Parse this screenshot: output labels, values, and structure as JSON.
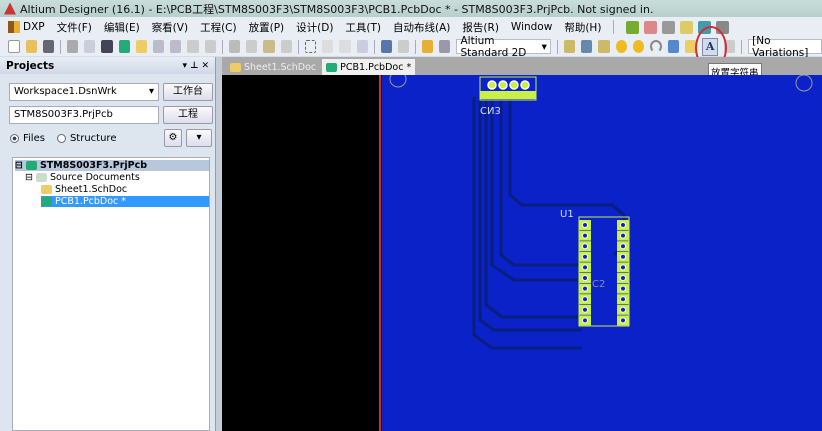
{
  "title": "Altium Designer (16.1) - E:\\PCB工程\\STM8S003F3\\STM8S003F3\\PCB1.PcbDoc * - STM8S003F3.PrjPcb. Not signed in.",
  "menu": [
    "DXP",
    "文件(F)",
    "编辑(E)",
    "察看(V)",
    "工程(C)",
    "放置(P)",
    "设计(D)",
    "工具(T)",
    "自动布线(A)",
    "报告(R)",
    "Window",
    "帮助(H)"
  ],
  "toolbar": {
    "view_mode": "Altium Standard 2D",
    "variations": "[No Variations]",
    "tooltip": "放置字符串"
  },
  "panel": {
    "title": "Projects",
    "workspace": "Workspace1.DsnWrk",
    "workspace_btn": "工作台",
    "project": "STM8S003F3.PrjPcb",
    "project_btn": "工程",
    "radio_files": "Files",
    "radio_structure": "Structure",
    "tree": {
      "project": "STM8S003F3.PrjPcb",
      "folder": "Source Documents",
      "items": [
        "Sheet1.SchDoc",
        "PCB1.PcbDoc *"
      ]
    }
  },
  "tabs": [
    "Sheet1.SchDoc",
    "PCB1.PcbDoc *"
  ],
  "pcb": {
    "labels": {
      "connector": "CN3",
      "chip": "U1",
      "cap": "C2"
    }
  },
  "colors": {
    "board": "#0a22c8",
    "pad": "#c8f048",
    "track": "#0a1e80",
    "highlight": "#d03030"
  }
}
